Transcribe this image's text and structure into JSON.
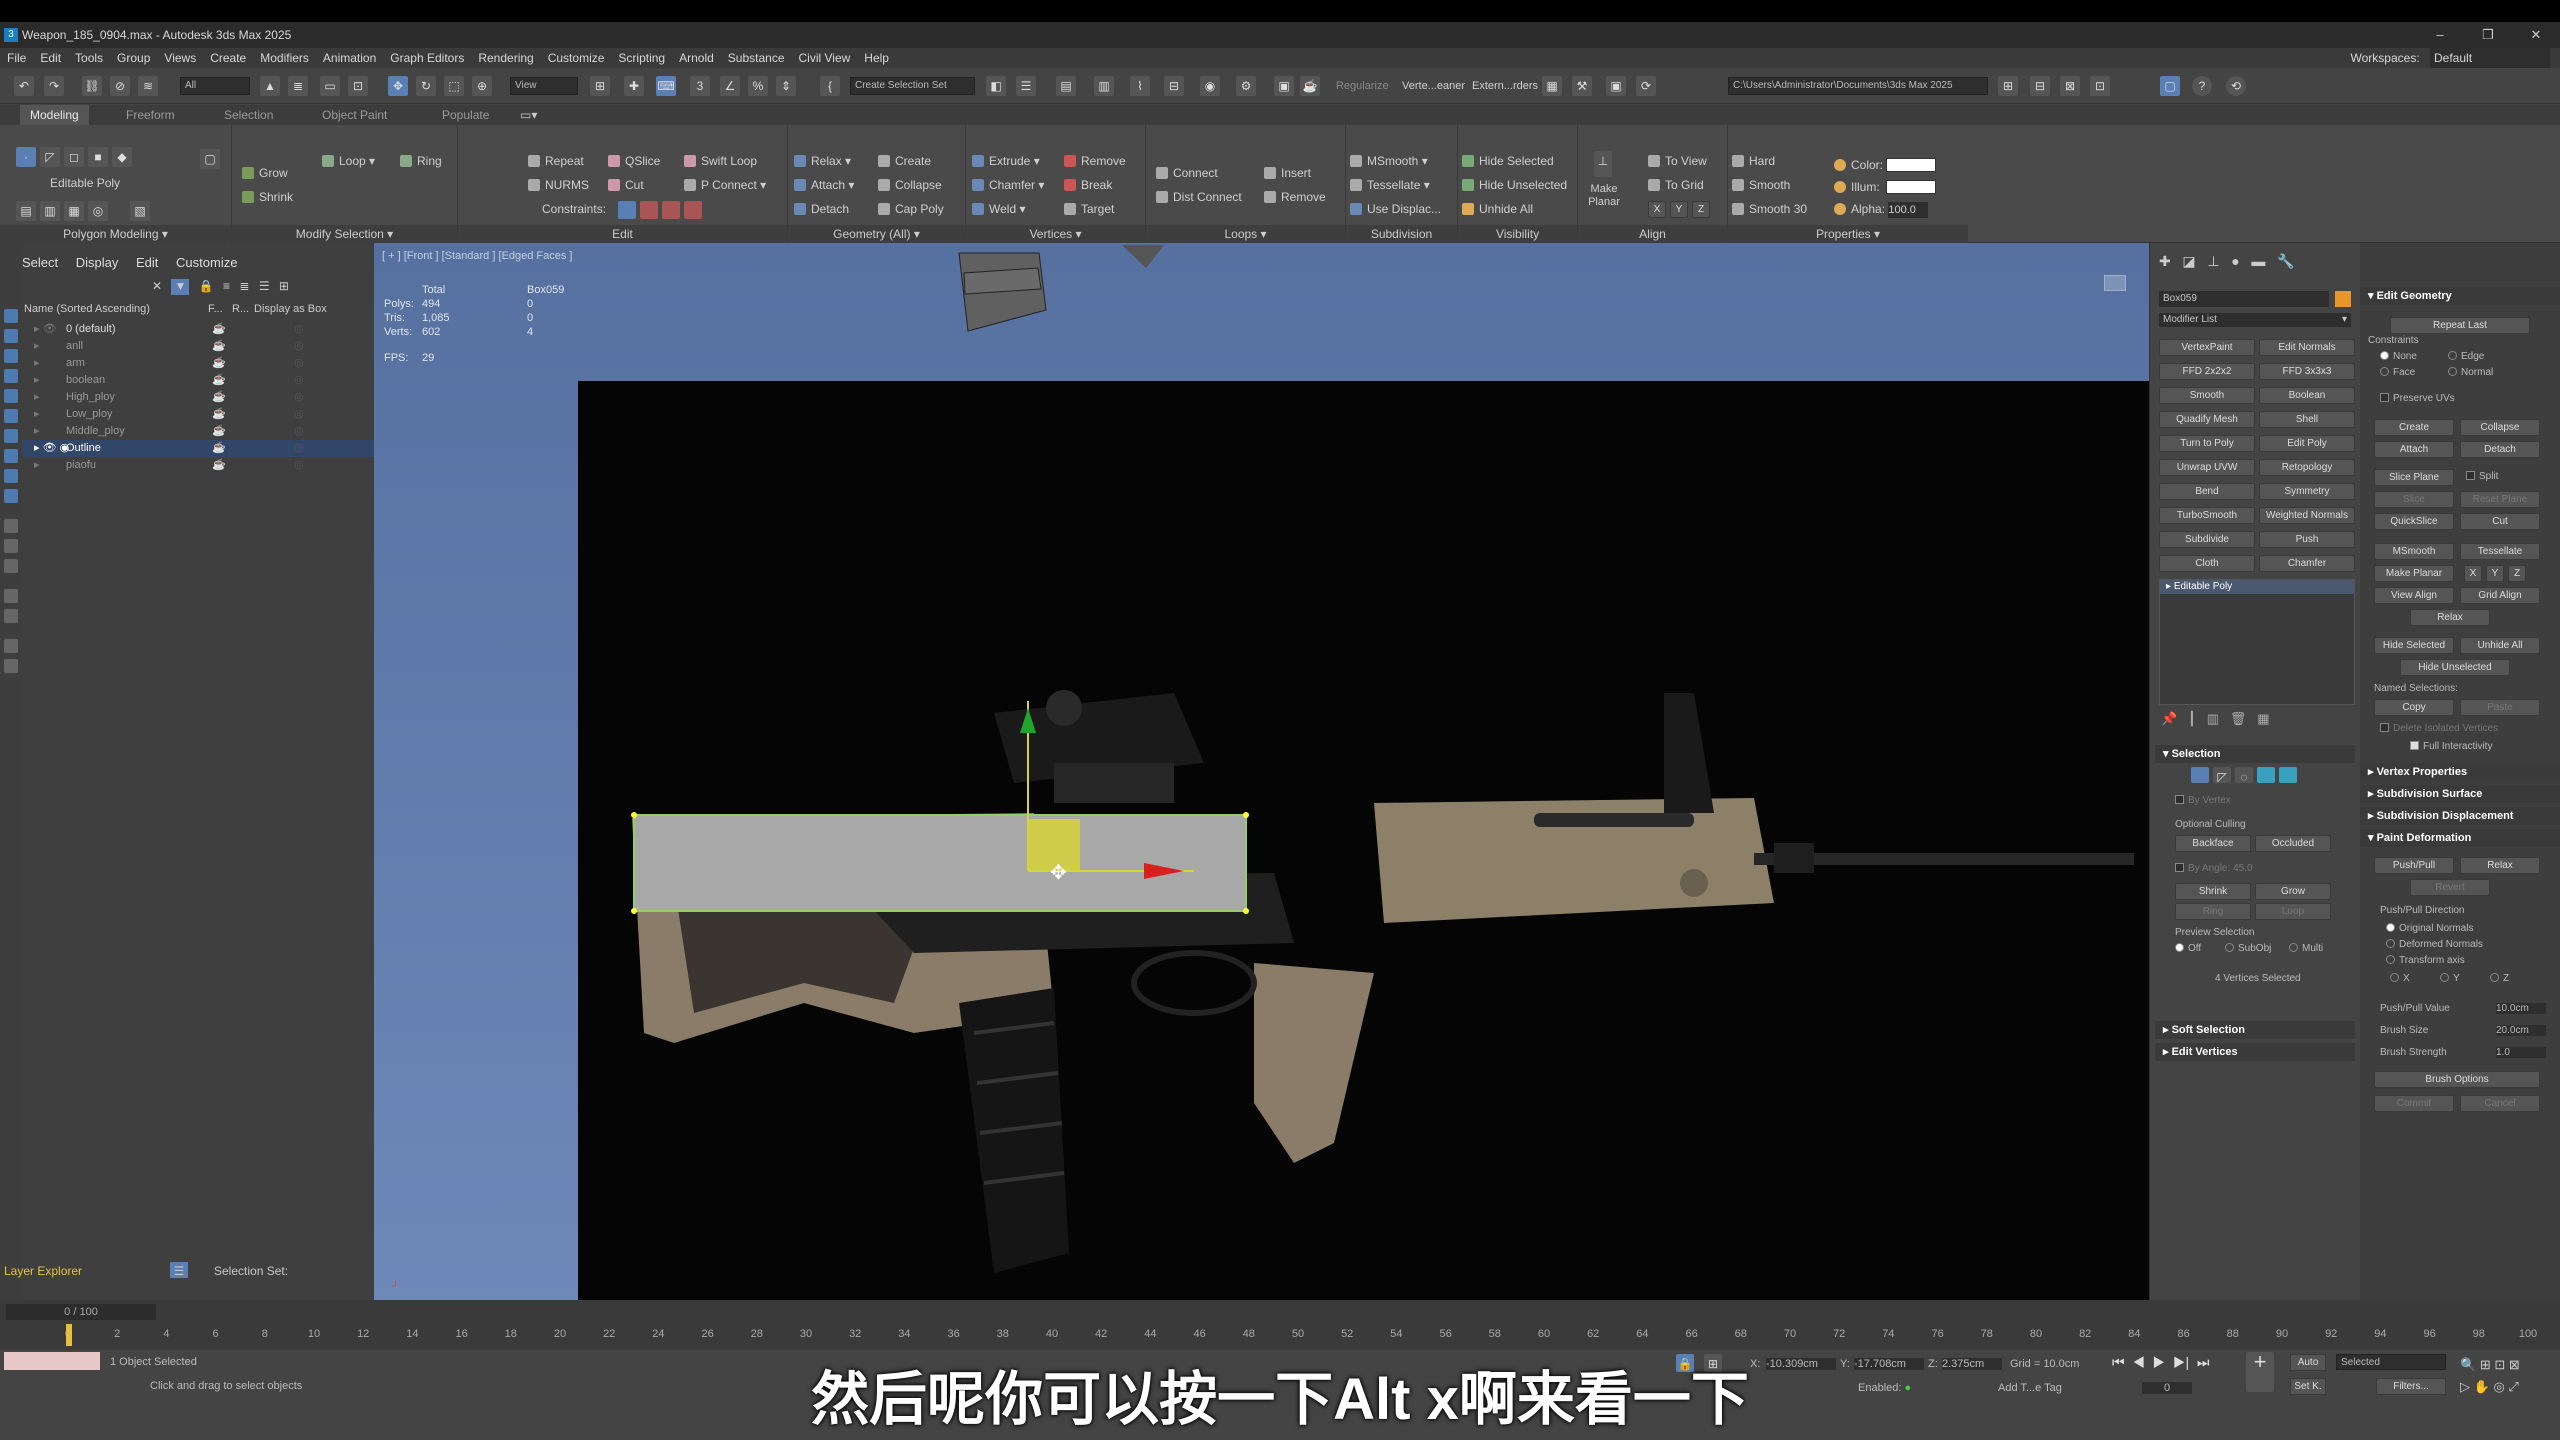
{
  "window": {
    "title": "Weapon_185_0904.max - Autodesk 3ds Max 2025",
    "controls": [
      "–",
      "❐",
      "✕"
    ]
  },
  "menu": [
    "File",
    "Edit",
    "Tools",
    "Group",
    "Views",
    "Create",
    "Modifiers",
    "Animation",
    "Graph Editors",
    "Rendering",
    "Customize",
    "Scripting",
    "Arnold",
    "Substance",
    "Civil View",
    "Help"
  ],
  "workspace": {
    "label": "Workspaces:",
    "value": "Default"
  },
  "toolbar": {
    "filter": "All",
    "view": "View",
    "selection_set": "Create Selection Set",
    "path": "C:\\Users\\Administrator\\Documents\\3ds Max 2025",
    "regularize": "Regularize",
    "vert_cleaner": "Verte...eaner",
    "ext_orders": "Extern...rders"
  },
  "ribbon_tabs": [
    "Modeling",
    "Freeform",
    "Selection",
    "Object Paint",
    "Populate"
  ],
  "ribbon": {
    "polygon_modeling": {
      "label": "Polygon Modeling",
      "sub": "Editable Poly"
    },
    "modify_selection": {
      "label": "Modify Selection",
      "grow": "Grow",
      "shrink": "Shrink",
      "loop": "Loop",
      "ring": "Ring"
    },
    "edit": {
      "label": "Edit",
      "repeat": "Repeat",
      "qslice": "QSlice",
      "swift_loop": "Swift Loop",
      "nurms": "NURMS",
      "cut": "Cut",
      "p_connect": "P Connect",
      "constraints": "Constraints:"
    },
    "geometry": {
      "label": "Geometry (All)",
      "relax": "Relax",
      "create": "Create",
      "attach": "Attach",
      "collapse": "Collapse",
      "detach": "Detach",
      "cap_poly": "Cap Poly"
    },
    "vertices": {
      "label": "Vertices",
      "extrude": "Extrude",
      "remove": "Remove",
      "chamfer": "Chamfer",
      "break": "Break",
      "weld": "Weld",
      "target": "Target"
    },
    "loops": {
      "label": "Loops",
      "connect": "Connect",
      "insert": "Insert",
      "dist_connect": "Dist Connect",
      "remove": "Remove"
    },
    "subdivision": {
      "label": "Subdivision",
      "msmooth": "MSmooth",
      "tessellate": "Tessellate",
      "use_displac": "Use Displac..."
    },
    "visibility": {
      "label": "Visibility",
      "hide_selected": "Hide Selected",
      "hide_unselected": "Hide Unselected",
      "unhide_all": "Unhide All"
    },
    "align": {
      "label": "Align",
      "make_planar": "Make Planar",
      "to_view": "To View",
      "to_grid": "To Grid",
      "x": "X",
      "y": "Y",
      "z": "Z"
    },
    "properties": {
      "label": "Properties",
      "hard": "Hard",
      "smooth": "Smooth",
      "smooth30": "Smooth 30",
      "color": "Color:",
      "illum": "Illum:",
      "alpha": "Alpha:",
      "alpha_value": "100.0"
    }
  },
  "scene_explorer": {
    "menu": [
      "Select",
      "Display",
      "Edit",
      "Customize"
    ],
    "headers": {
      "name": "Name (Sorted Ascending)",
      "f": "F...",
      "r": "R...",
      "box": "Display as Box"
    },
    "rows": [
      "0 (default)",
      "anll",
      "arm",
      "boolean",
      "High_ploy",
      "Low_ploy",
      "Middle_ploy",
      "Outline",
      "piaofu"
    ],
    "footer": {
      "explorer": "Layer Explorer",
      "selset": "Selection Set:"
    }
  },
  "viewport": {
    "label": "[ + ] [Front ] [Standard ] [Edged Faces ]",
    "stats": {
      "total": "Total",
      "obj": "Box059",
      "polys_l": "Polys:",
      "polys_t": "494",
      "polys_o": "0",
      "tris_l": "Tris:",
      "tris_t": "1,085",
      "tris_o": "0",
      "verts_l": "Verts:",
      "verts_t": "602",
      "verts_o": "4",
      "fps_l": "FPS:",
      "fps": "29"
    }
  },
  "command_panel": {
    "object_name": "Box059",
    "modifier_list": "Modifier List",
    "modifier_buttons": [
      "VertexPaint",
      "Edit Normals",
      "FFD 2x2x2",
      "FFD 3x3x3",
      "Smooth",
      "Boolean",
      "Quadify Mesh",
      "Shell",
      "Turn to Poly",
      "Edit Poly",
      "Unwrap UVW",
      "Retopology",
      "Bend",
      "Symmetry",
      "TurboSmooth",
      "Weighted Normals",
      "Subdivide",
      "Push",
      "Cloth",
      "Chamfer"
    ],
    "stack_item": "Editable Poly",
    "selection": {
      "title": "Selection",
      "by_vertex": "By Vertex",
      "optional_culling": "Optional Culling",
      "backface": "Backface",
      "occluded": "Occluded",
      "by_angle": "By Angle:",
      "angle": "45.0",
      "shrink": "Shrink",
      "grow": "Grow",
      "ring": "Ring",
      "loop": "Loop",
      "preview": "Preview Selection",
      "off": "Off",
      "subobj": "SubObj",
      "multi": "Multi",
      "status": "4 Vertices Selected"
    },
    "soft_selection": "Soft Selection",
    "edit_vertices": "Edit Vertices",
    "edit_geometry": {
      "title": "Edit Geometry",
      "repeat_last": "Repeat Last",
      "constraints": "Constraints",
      "none": "None",
      "edge": "Edge",
      "face": "Face",
      "normal": "Normal",
      "preserve_uvs": "Preserve UVs",
      "create": "Create",
      "collapse": "Collapse",
      "attach": "Attach",
      "detach": "Detach",
      "slice_plane": "Slice Plane",
      "split": "Split",
      "slice": "Slice",
      "reset_plane": "Reset Plane",
      "quickslice": "QuickSlice",
      "cut": "Cut",
      "msmooth": "MSmooth",
      "tessellate": "Tessellate",
      "make_planar": "Make Planar",
      "x": "X",
      "y": "Y",
      "z": "Z",
      "view_align": "View Align",
      "grid_align": "Grid Align",
      "relax": "Relax",
      "hide_selected": "Hide Selected",
      "unhide_all": "Unhide All",
      "hide_unselected": "Hide Unselected",
      "named_sel": "Named Selections:",
      "copy": "Copy",
      "paste": "Paste",
      "delete_isolated": "Delete Isolated Vertices",
      "full_interactivity": "Full Interactivity"
    },
    "vertex_properties": "Vertex Properties",
    "subdivision_surface": "Subdivision Surface",
    "subdivision_displacement": "Subdivision Displacement",
    "paint_deformation": {
      "title": "Paint Deformation",
      "push_pull": "Push/Pull",
      "relax": "Relax",
      "revert": "Revert",
      "direction": "Push/Pull Direction",
      "original": "Original Normals",
      "deformed": "Deformed Normals",
      "transform_axis": "Transform axis",
      "x": "X",
      "y": "Y",
      "z": "Z",
      "value_l": "Push/Pull Value",
      "value": "10.0cm",
      "size_l": "Brush Size",
      "size": "20.0cm",
      "strength_l": "Brush Strength",
      "strength": "1.0",
      "brush_options": "Brush Options",
      "commit": "Commit",
      "cancel": "Cancel"
    }
  },
  "timeline": {
    "frame": "0 / 100",
    "ticks": [
      "0",
      "2",
      "4",
      "6",
      "8",
      "10",
      "12",
      "14",
      "16",
      "18",
      "20",
      "22",
      "24",
      "26",
      "28",
      "30",
      "32",
      "34",
      "36",
      "38",
      "40",
      "42",
      "44",
      "46",
      "48",
      "50",
      "52",
      "54",
      "56",
      "58",
      "60",
      "62",
      "64",
      "66",
      "68",
      "70",
      "72",
      "74",
      "76",
      "78",
      "80",
      "82",
      "84",
      "86",
      "88",
      "90",
      "92",
      "94",
      "96",
      "98",
      "100"
    ]
  },
  "status": {
    "selected": "1 Object Selected",
    "hint": "Click and drag to select objects",
    "x_l": "X:",
    "x": "-10.309cm",
    "y_l": "Y:",
    "y": "-17.708cm",
    "z_l": "Z:",
    "z": "2.375cm",
    "grid": "Grid = 10.0cm",
    "enabled": "Enabled:",
    "add_tag": "Add T...e Tag",
    "auto": "Auto",
    "selected_dd": "Selected",
    "set_k": "Set K.",
    "filters": "Filters..."
  },
  "subtitle": "然后呢你可以按一下Alt x啊来看一下"
}
